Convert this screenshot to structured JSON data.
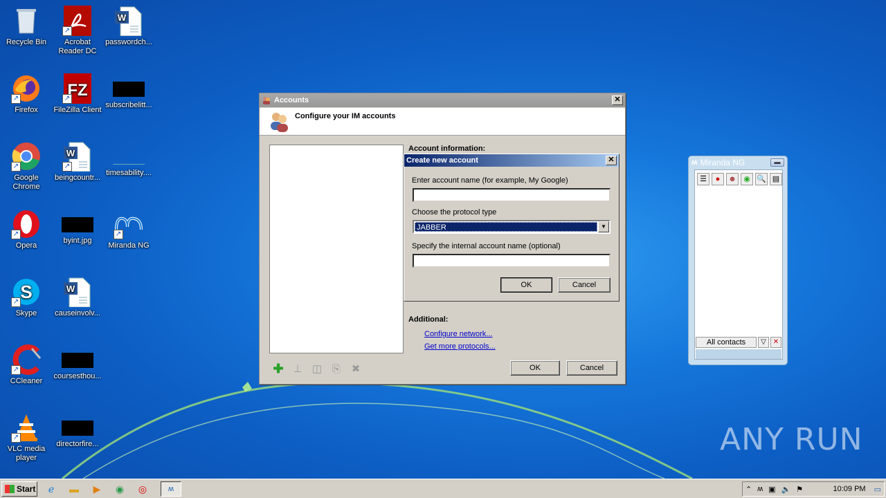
{
  "desktop": {
    "icons": [
      {
        "label": "Recycle Bin",
        "icon": "recycle-bin-icon"
      },
      {
        "label": "Acrobat Reader DC",
        "icon": "acrobat-icon"
      },
      {
        "label": "passwordch...",
        "icon": "word-doc-icon"
      },
      {
        "label": "Firefox",
        "icon": "firefox-icon"
      },
      {
        "label": "FileZilla Client",
        "icon": "filezilla-icon"
      },
      {
        "label": "subscribelitt...",
        "icon": "black-thumbnail-icon"
      },
      {
        "label": "Google Chrome",
        "icon": "chrome-icon"
      },
      {
        "label": "beingcountr...",
        "icon": "word-doc-icon"
      },
      {
        "label": "timesability....",
        "icon": "file-icon"
      },
      {
        "label": "Opera",
        "icon": "opera-icon"
      },
      {
        "label": "byint.jpg",
        "icon": "black-thumbnail-icon"
      },
      {
        "label": "Miranda NG",
        "icon": "miranda-icon"
      },
      {
        "label": "Skype",
        "icon": "skype-icon"
      },
      {
        "label": "causeinvolv...",
        "icon": "word-doc-icon"
      },
      {
        "label": "CCleaner",
        "icon": "ccleaner-icon"
      },
      {
        "label": "coursesthou...",
        "icon": "black-thumbnail-icon"
      },
      {
        "label": "VLC media player",
        "icon": "vlc-icon"
      },
      {
        "label": "directorfire...",
        "icon": "black-thumbnail-icon"
      }
    ],
    "watermark": "ANY RUN"
  },
  "accounts_window": {
    "title": "Accounts",
    "header": "Configure your IM accounts",
    "account_information_label": "Account information:",
    "additional_label": "Additional:",
    "links": {
      "configure_network": "Configure network...",
      "get_more_protocols": "Get more protocols..."
    },
    "ok_label": "OK",
    "cancel_label": "Cancel",
    "close_glyph": "✕"
  },
  "create_dialog": {
    "title": "Create new account",
    "account_name_label": "Enter account name (for example, My Google)",
    "account_name_value": "",
    "protocol_label": "Choose the protocol type",
    "protocol_value": "JABBER",
    "internal_name_label": "Specify the internal account name (optional)",
    "internal_name_value": "",
    "ok_label": "OK",
    "cancel_label": "Cancel",
    "close_glyph": "✕"
  },
  "miranda_window": {
    "title": "Miranda NG",
    "all_contacts_label": "All contacts"
  },
  "taskbar": {
    "start_label": "Start",
    "clock": "10:09 PM"
  }
}
